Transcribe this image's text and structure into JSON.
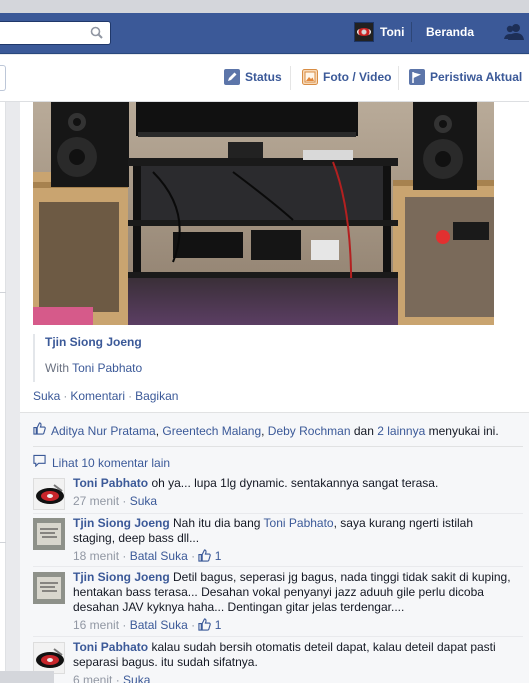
{
  "topbar": {
    "profile_name": "Toni",
    "home_label": "Beranda",
    "icons": {
      "search": "search-icon",
      "friends": "friend-requests-icon"
    },
    "brand_color": "#3b5998"
  },
  "composer": {
    "status_label": "Status",
    "photo_label": "Foto / Video",
    "event_label": "Peristiwa Aktual"
  },
  "post": {
    "attachment_name": "Tjin Siong Joeng",
    "with_prefix": "With",
    "with_name": "Toni Pabhato",
    "actions": {
      "like": "Suka",
      "comment": "Komentari",
      "share": "Bagikan"
    }
  },
  "likes": {
    "names": [
      "Aditya Nur Pratama",
      "Greentech Malang",
      "Deby Rochman"
    ],
    "and_word": "dan",
    "others_link": "2 lainnya",
    "suffix": "menyukai ini."
  },
  "more_comments": "Lihat 10 komentar lain",
  "comments": [
    {
      "author": "Toni Pabhato",
      "text": "oh ya... lupa 1lg dynamic. sentakannya sangat terasa.",
      "time": "27 menit",
      "action": "Suka",
      "likes": ""
    },
    {
      "author": "Tjin Siong Joeng",
      "text_before": "Nah itu dia bang",
      "mention": "Toni Pabhato",
      "text_after": ", saya kurang ngerti istilah staging, deep bass dll...",
      "time": "18 menit",
      "action": "Batal Suka",
      "likes": "1"
    },
    {
      "author": "Tjin Siong Joeng",
      "text": "Detil bagus, seperasi jg bagus, nada tinggi tidak sakit di kuping, hentakan bass terasa... Desahan vokal penyanyi jazz aduuh gile perlu dicoba desahan JAV kyknya haha... Dentingan gitar jelas terdengar....",
      "time": "16 menit",
      "action": "Batal Suka",
      "likes": "1"
    },
    {
      "author": "Toni Pabhato",
      "text": "kalau sudah bersih otomatis deteil dapat, kalau deteil dapat pasti separasi bagus. itu sudah sifatnya.",
      "time": "6 menit",
      "action": "Suka",
      "likes": ""
    }
  ]
}
